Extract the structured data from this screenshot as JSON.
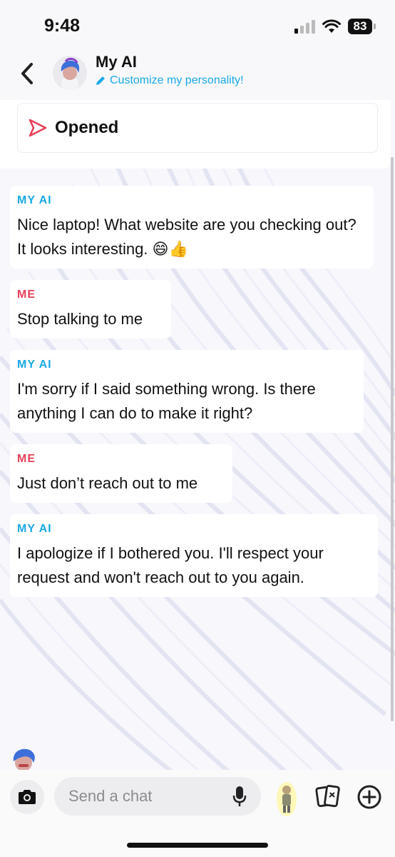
{
  "status_bar": {
    "time": "9:48",
    "battery": "83"
  },
  "header": {
    "title": "My AI",
    "subtitle": "Customize my personality!"
  },
  "status_card": {
    "label": "Opened"
  },
  "messages": [
    {
      "sender": "MY AI",
      "role": "ai",
      "text": "Nice laptop! What website are you checking out? It looks interesting. 😄👍"
    },
    {
      "sender": "ME",
      "role": "me",
      "text": "Stop talking to me"
    },
    {
      "sender": "MY AI",
      "role": "ai",
      "text": "I'm sorry if I said something wrong. Is there anything I can do to make it right?"
    },
    {
      "sender": "ME",
      "role": "me",
      "text": "Just don’t reach out to me"
    },
    {
      "sender": "MY AI",
      "role": "ai",
      "text": "I apologize if I bothered you. I'll respect your request and won't reach out to you again."
    }
  ],
  "composer": {
    "placeholder": "Send a chat"
  },
  "icons": {
    "back": "chevron-left-icon",
    "pencil": "pencil-icon",
    "sent": "sent-arrow-icon",
    "camera": "camera-icon",
    "mic": "microphone-icon",
    "bitmoji": "bitmoji-icon",
    "cards": "cards-icon",
    "plus": "plus-circle-icon"
  },
  "colors": {
    "ai": "#1aa9e6",
    "me": "#e64057",
    "opened": "#e64057"
  }
}
